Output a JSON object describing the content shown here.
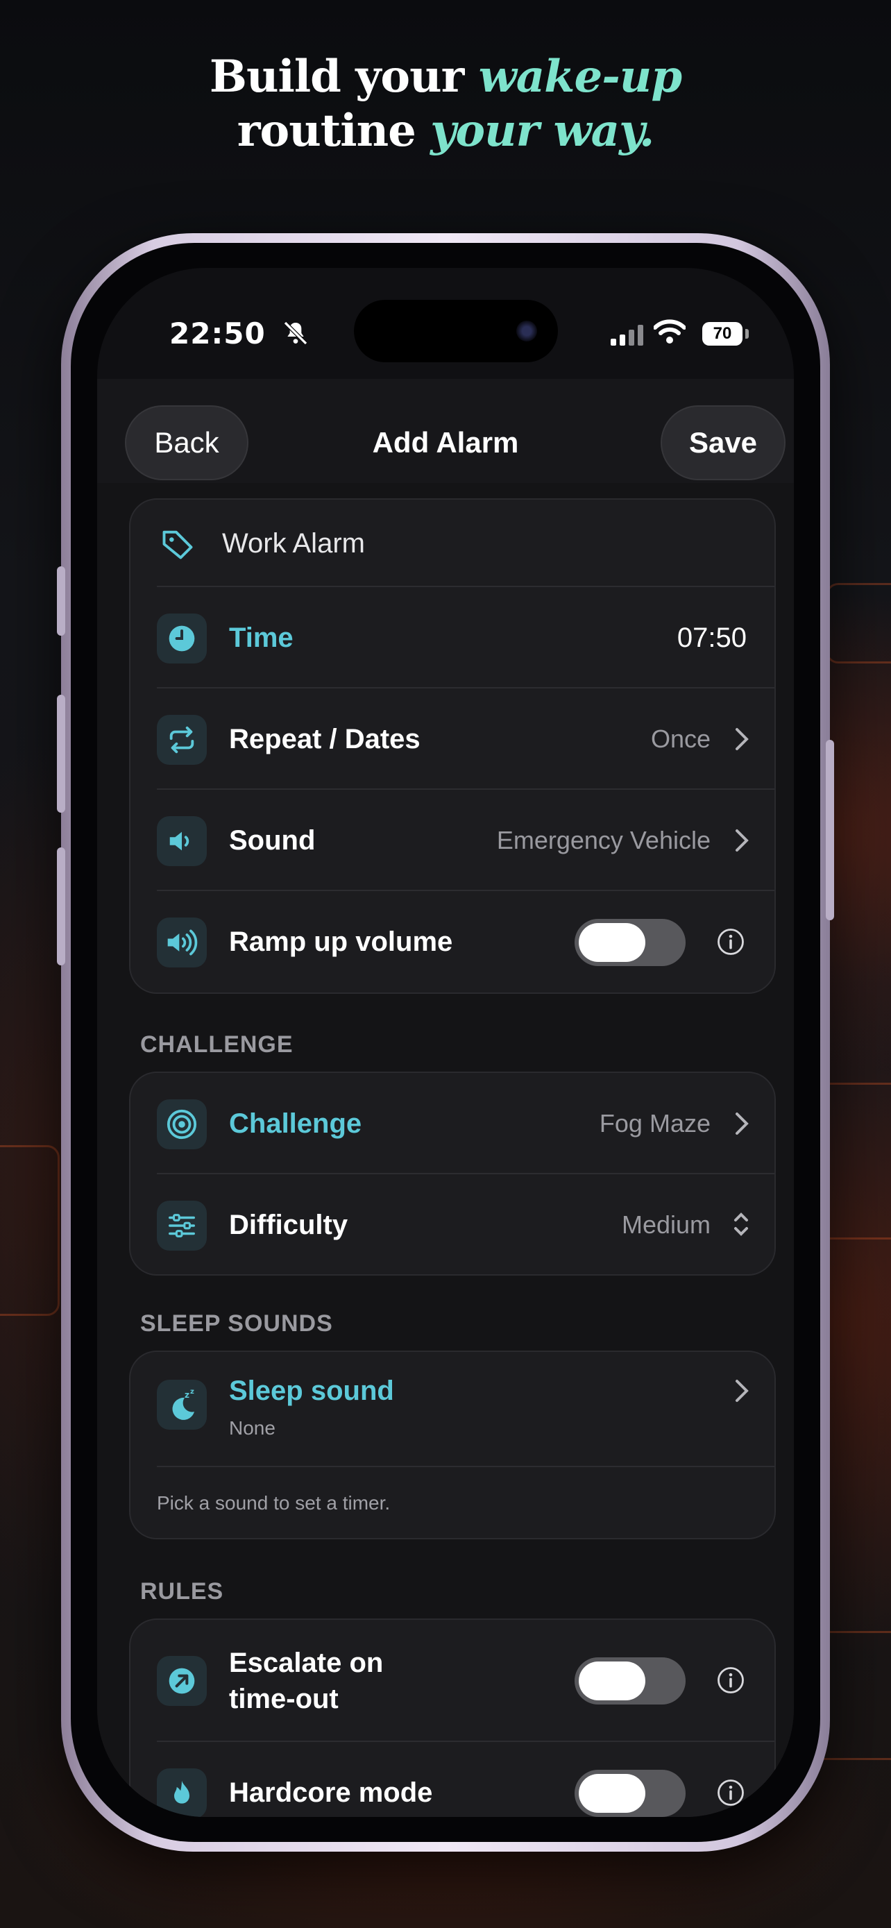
{
  "headline": {
    "line1_plain": "Build your",
    "line1_accent": "wake-up",
    "line2_plain": "routine",
    "line2_accent": "your way."
  },
  "status_bar": {
    "time": "22:50",
    "battery": "70"
  },
  "nav": {
    "back": "Back",
    "title": "Add Alarm",
    "save": "Save"
  },
  "alarm": {
    "name": "Work Alarm",
    "time_label": "Time",
    "time_value": "07:50",
    "repeat_label": "Repeat / Dates",
    "repeat_value": "Once",
    "sound_label": "Sound",
    "sound_value": "Emergency Vehicle",
    "ramp_label": "Ramp up volume",
    "ramp_on": false
  },
  "challenge_section": {
    "header": "CHALLENGE",
    "challenge_label": "Challenge",
    "challenge_value": "Fog Maze",
    "difficulty_label": "Difficulty",
    "difficulty_value": "Medium"
  },
  "sleep_section": {
    "header": "SLEEP SOUNDS",
    "label": "Sleep sound",
    "value": "None",
    "hint": "Pick a sound to set a timer."
  },
  "rules_section": {
    "header": "RULES",
    "escalate_line1": "Escalate on",
    "escalate_line2": "time-out",
    "hardcore_label": "Hardcore mode"
  },
  "colors": {
    "accent": "#5cc9d9",
    "headline_accent": "#7ee3cc",
    "background": "#101013"
  }
}
